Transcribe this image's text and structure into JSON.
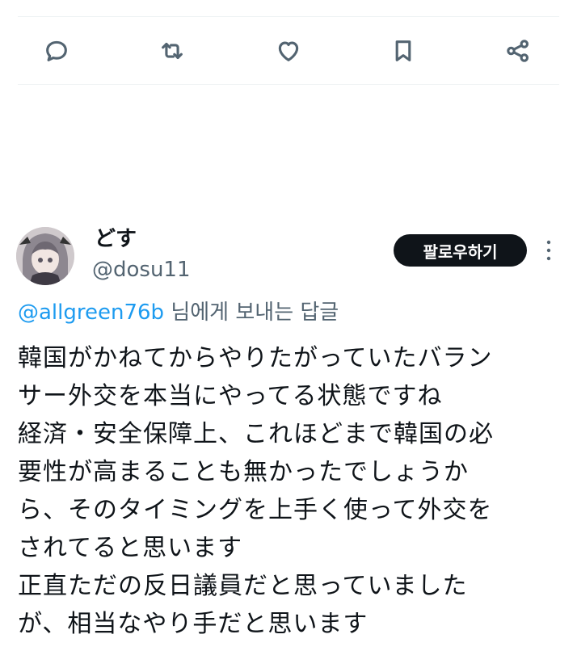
{
  "actions": [
    {
      "name": "reply",
      "icon": "reply-icon"
    },
    {
      "name": "retweet",
      "icon": "retweet-icon"
    },
    {
      "name": "like",
      "icon": "heart-icon"
    },
    {
      "name": "bookmark",
      "icon": "bookmark-icon"
    },
    {
      "name": "share",
      "icon": "share-icon"
    }
  ],
  "reply": {
    "display_name": "どす",
    "handle": "@dosu11",
    "follow_label": "팔로우하기",
    "reply_to": {
      "mention": "@allgreen76b",
      "suffix": " 님에게 보내는 답글"
    },
    "text_lines": [
      "韓国がかねてからやりたがっていたバラン",
      "サー外交を本当にやってる状態ですね",
      "経済・安全保障上、これほどまで韓国の必",
      "要性が高まることも無かったでしょうか",
      "ら、そのタイミングを上手く使って外交を",
      "されてると思います",
      "正直ただの反日議員だと思っていました",
      "が、相当なやり手だと思います"
    ]
  },
  "colors": {
    "accent": "#1d9bf0",
    "text": "#0f1419",
    "muted": "#536471"
  }
}
